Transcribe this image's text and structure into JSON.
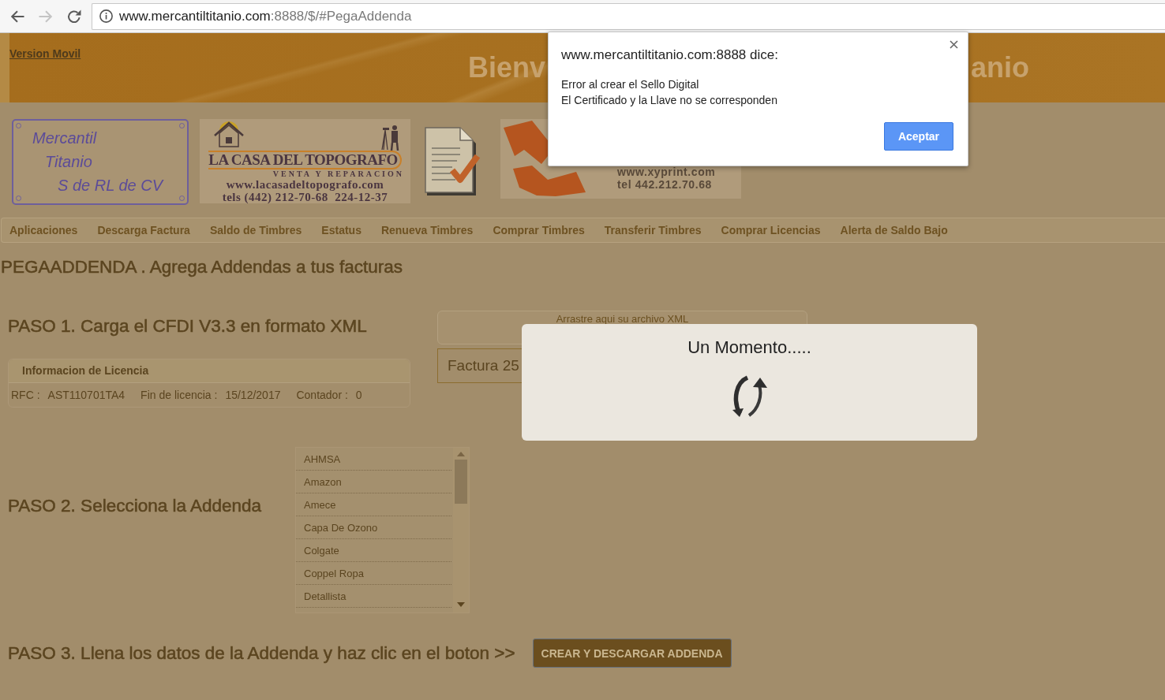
{
  "browser": {
    "nav_buttons": [
      {
        "kind": "back",
        "disabled": false
      },
      {
        "kind": "forward",
        "disabled": true
      },
      {
        "kind": "reload",
        "disabled": false
      }
    ],
    "url": {
      "host": "www.mercantiltitanio.com",
      "path": ":8888/$/#PegaAddenda"
    }
  },
  "header": {
    "link": "Version Movil",
    "title_fragments": [
      "Bienv",
      "anio"
    ]
  },
  "logos": [
    {
      "kind": "plate",
      "lines": [
        "Mercantil",
        "Titanio",
        "S de RL de CV"
      ]
    },
    {
      "kind": "survey_advert",
      "title": "LA CASA DEL TOPOGRAFO",
      "subtitle": "VENTA Y REPARACION",
      "lines": [
        "www.lacasadeltopografo.com",
        "tels (442) 212-70-68  224-12-37"
      ]
    },
    {
      "kind": "document"
    },
    {
      "kind": "print_advert",
      "lines": [
        "www.xyprint.com",
        "tel 442.212.70.68"
      ]
    }
  ],
  "menu": [
    "Aplicaciones",
    "Descarga Factura",
    "Saldo de Timbres",
    "Estatus",
    "Renueva Timbres",
    "Comprar Timbres",
    "Transferir Timbres",
    "Comprar Licencias",
    "Alerta de Saldo Bajo"
  ],
  "page_title": "PEGAADDENDA . Agrega Addendas a tus facturas",
  "step1": {
    "heading": "PASO 1. Carga el CFDI V3.3 en formato XML",
    "license": {
      "title": "Informacion de Licencia",
      "fields": [
        {
          "label": "RFC :",
          "value": "AST110701TA4"
        },
        {
          "label": "Fin de licencia :",
          "value": "15/12/2017"
        },
        {
          "label": "Contador :",
          "value": "0"
        }
      ]
    },
    "drop_zone": {
      "label": "Arrastre aqui su archivo XML"
    },
    "file_field": {
      "value": "Factura 25"
    }
  },
  "step2": {
    "heading": "PASO 2. Selecciona la Addenda",
    "addendas": [
      {
        "label": "AHMSA",
        "selected": false
      },
      {
        "label": "Amazon",
        "selected": false
      },
      {
        "label": "Amece",
        "selected": false
      },
      {
        "label": "Capa De Ozono",
        "selected": false
      },
      {
        "label": "Colgate",
        "selected": false
      },
      {
        "label": "Coppel Ropa",
        "selected": false
      },
      {
        "label": "Detallista",
        "selected": false
      }
    ]
  },
  "step3": {
    "heading": "PASO 3. Llena los datos de la Addenda y haz clic en el boton >>",
    "button": "CREAR Y DESCARGAR ADDENDA"
  },
  "loading": {
    "message": "Un Momento....."
  },
  "alert": {
    "title": "www.mercantiltitanio.com:8888 dice:",
    "message_lines": [
      "Error al crear el Sello Digital",
      "El Certificado y la Llave no se corresponden"
    ],
    "button": "Aceptar"
  }
}
